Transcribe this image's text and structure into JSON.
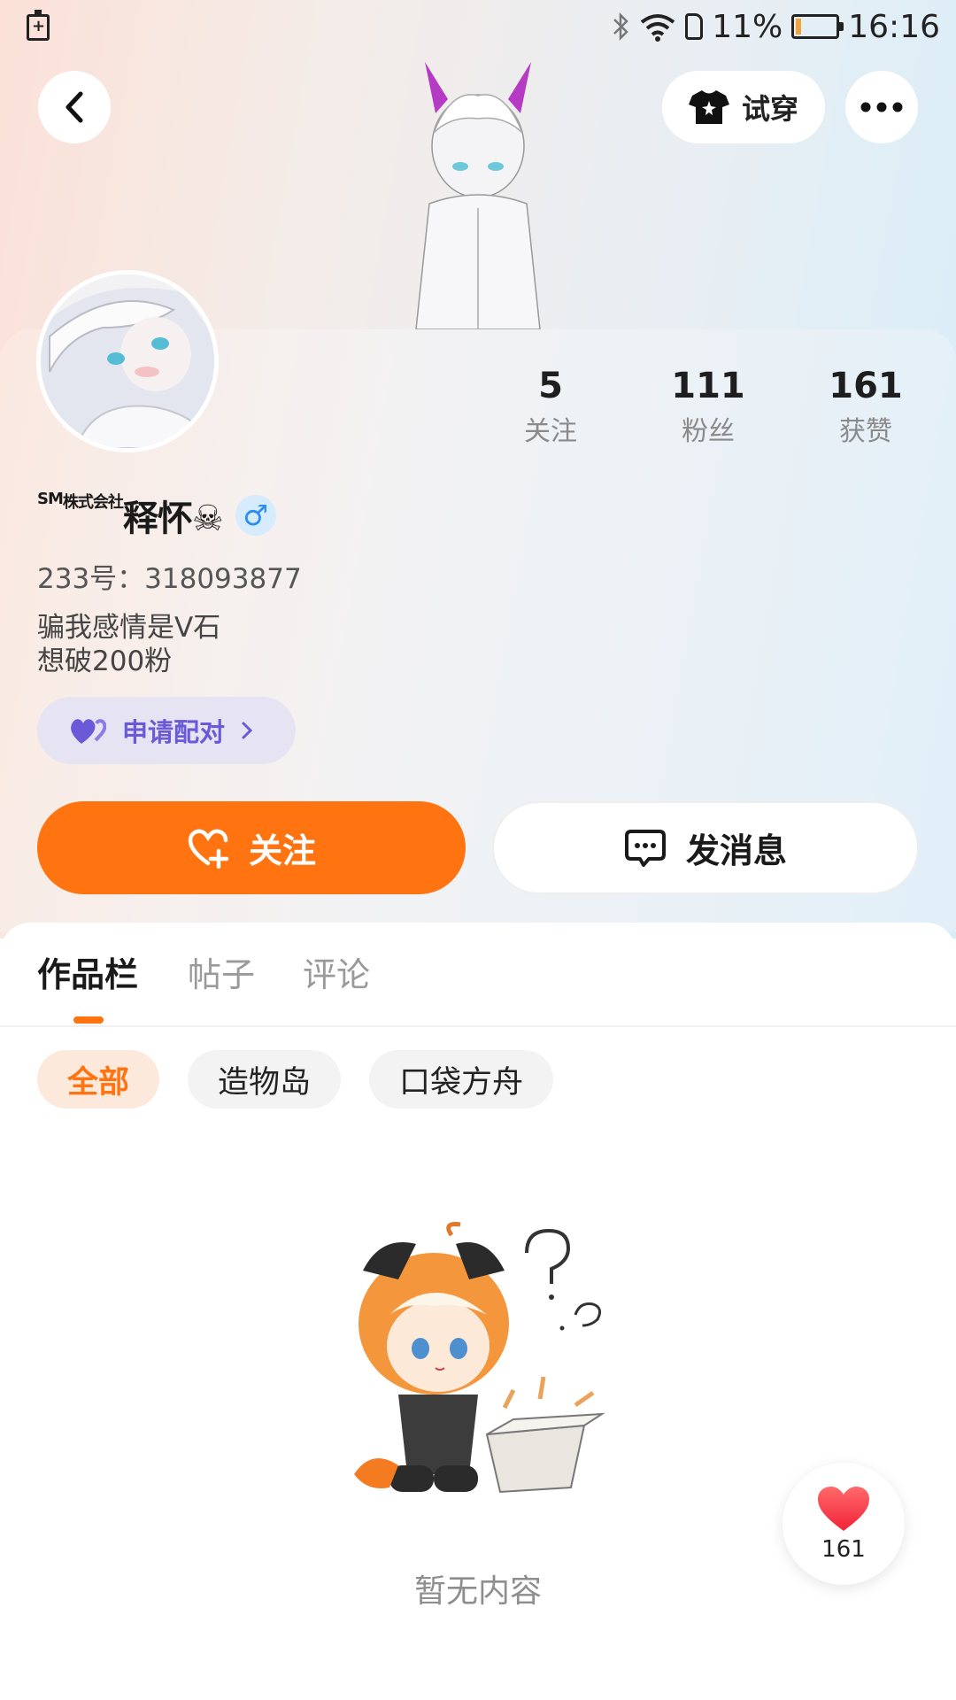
{
  "status_bar": {
    "battery_percent": "11%",
    "time": "16:16"
  },
  "header": {
    "tryon_label": "试穿"
  },
  "profile": {
    "username_prefix": "SM",
    "username_corp": "株式会社",
    "username_main": "释怀☠",
    "gender_symbol": "♂",
    "uid": "233号：318093877",
    "bio_line1": "骗我感情是V石",
    "bio_line2": "想破200粉",
    "match_label": "申请配对"
  },
  "stats": [
    {
      "value": "5",
      "label": "关注"
    },
    {
      "value": "111",
      "label": "粉丝"
    },
    {
      "value": "161",
      "label": "获赞"
    }
  ],
  "actions": {
    "follow_label": "关注",
    "message_label": "发消息"
  },
  "tabs": [
    {
      "label": "作品栏",
      "active": true
    },
    {
      "label": "帖子",
      "active": false
    },
    {
      "label": "评论",
      "active": false
    }
  ],
  "chips": [
    {
      "label": "全部",
      "active": true
    },
    {
      "label": "造物岛",
      "active": false
    },
    {
      "label": "口袋方舟",
      "active": false
    }
  ],
  "empty_state": {
    "text": "暂无内容"
  },
  "like_fab": {
    "count": "161"
  },
  "colors": {
    "accent": "#ff7311",
    "match_purple": "#6a5ad8",
    "gender_blue": "#2e8ef0"
  }
}
